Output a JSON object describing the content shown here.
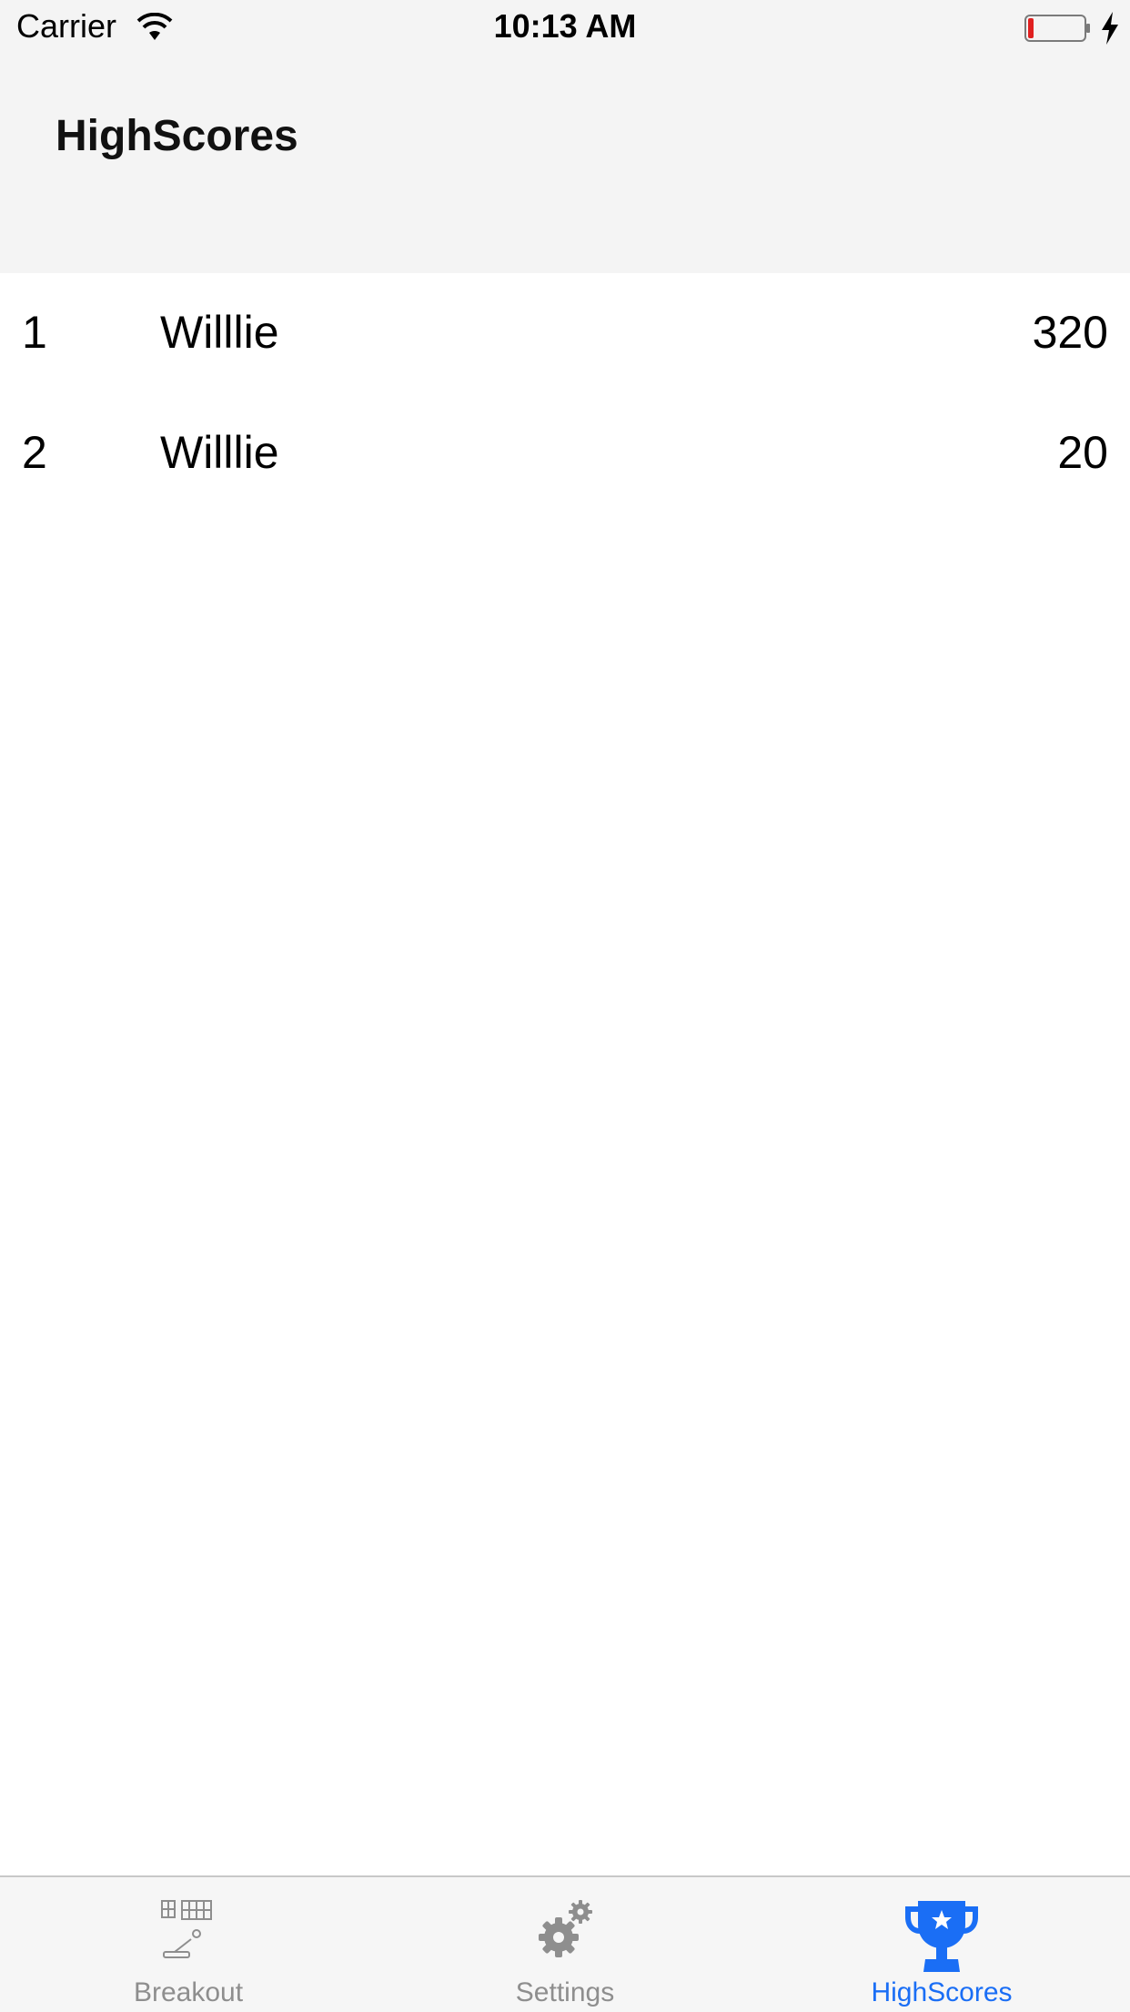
{
  "status_bar": {
    "carrier": "Carrier",
    "time": "10:13 AM",
    "icons": [
      "wifi-icon",
      "battery-icon",
      "charging-bolt-icon"
    ]
  },
  "header": {
    "title": "HighScores"
  },
  "scores": [
    {
      "rank": "1",
      "name": "Willlie",
      "score": "320"
    },
    {
      "rank": "2",
      "name": "Willlie",
      "score": "20"
    }
  ],
  "tab_bar": {
    "tabs": [
      {
        "label": "Breakout",
        "icon": "breakout-icon",
        "active": false
      },
      {
        "label": "Settings",
        "icon": "gear-icon",
        "active": false
      },
      {
        "label": "HighScores",
        "icon": "trophy-icon",
        "active": true
      }
    ]
  },
  "colors": {
    "accent": "#1a6ef5",
    "inactive": "#8e8e8e",
    "bar_bg": "#f4f4f4",
    "battery_low": "#e02020"
  }
}
